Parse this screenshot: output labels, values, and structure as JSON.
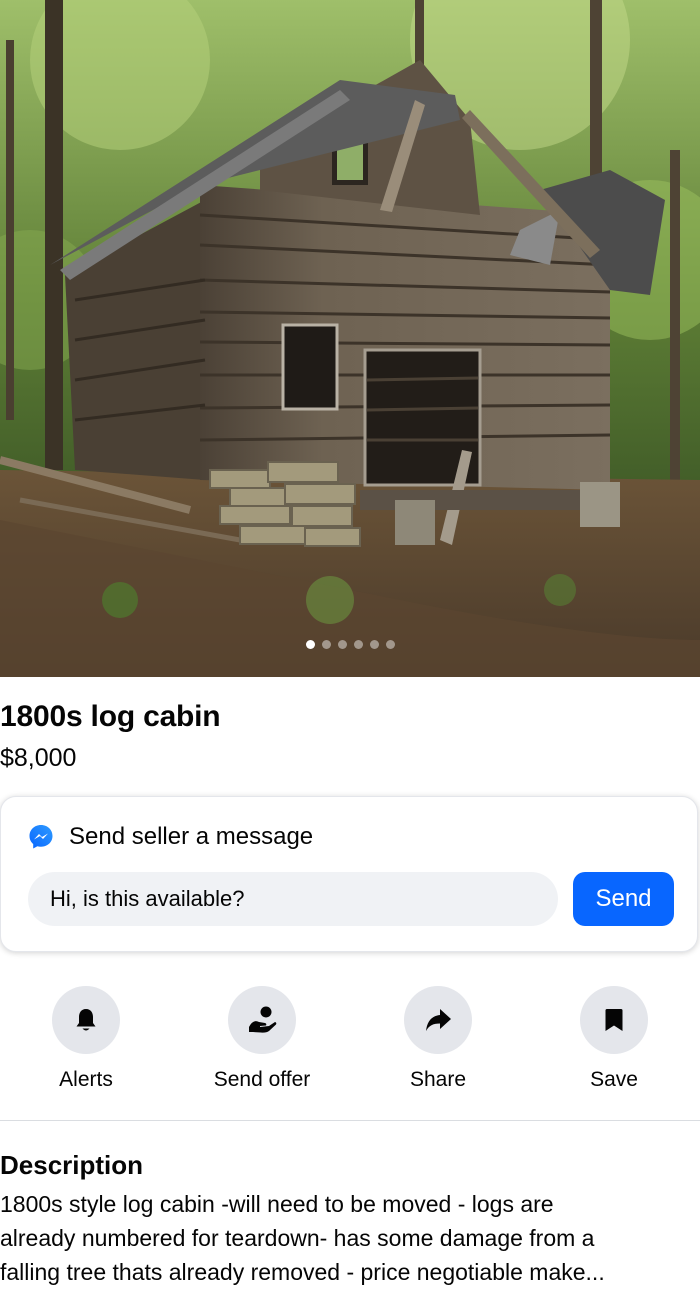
{
  "listing": {
    "title": "1800s log cabin",
    "price": "$8,000",
    "photo": {
      "image_count": 6,
      "active_index": 0,
      "icon": "cabin-photo"
    }
  },
  "message_card": {
    "icon": "messenger-icon",
    "heading": "Send seller a message",
    "input_value": "Hi, is this available?",
    "send_label": "Send",
    "accent_color": "#0866ff"
  },
  "actions": [
    {
      "label": "Alerts",
      "icon": "bell-icon"
    },
    {
      "label": "Send offer",
      "icon": "offer-hand-icon"
    },
    {
      "label": "Share",
      "icon": "share-arrow-icon"
    },
    {
      "label": "Save",
      "icon": "bookmark-icon"
    }
  ],
  "description": {
    "heading": "Description",
    "line1": "1800s style log cabin -will need to be moved - logs are",
    "line2": "already numbered for teardown- has some damage from a",
    "line3": "falling tree thats already removed - price negotiable make..."
  }
}
